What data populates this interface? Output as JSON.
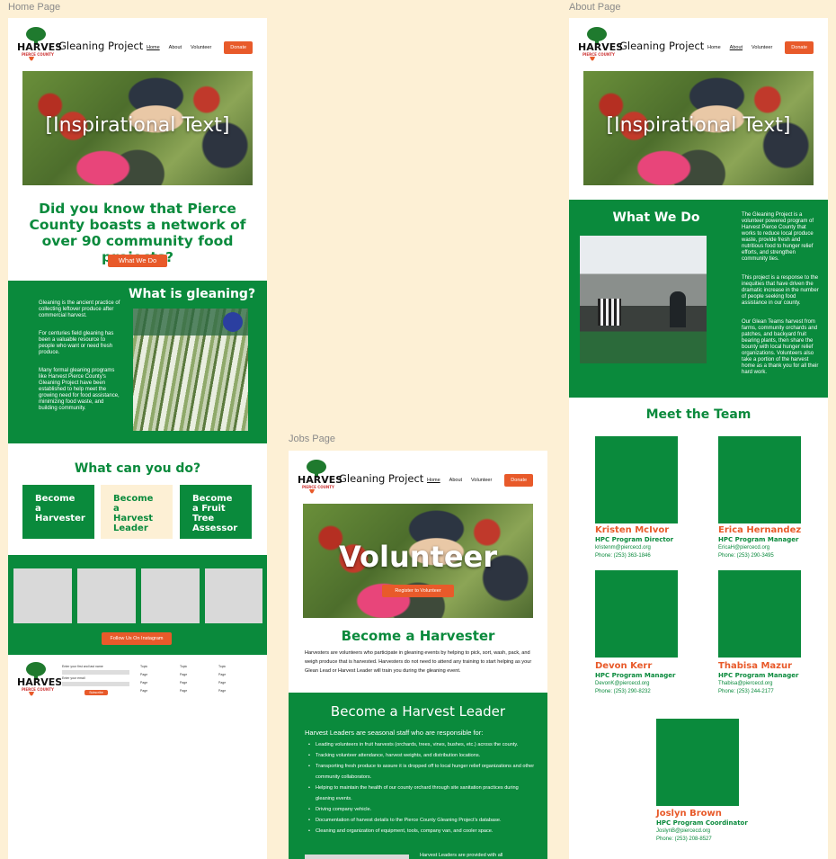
{
  "labels": {
    "home": "Home Page",
    "about": "About Page",
    "jobs": "Jobs Page"
  },
  "brand": {
    "logo_main": "HARVEST",
    "logo_sub": "PIERCE COUNTY",
    "site_title": "Gleaning Project"
  },
  "nav": {
    "home": "Home",
    "about": "About",
    "volunteer": "Volunteer",
    "donate": "Donate"
  },
  "home": {
    "hero_text": "[Inspirational Text]",
    "intro_heading": "Did you know that Pierce County boasts a network of over 90 community food projects?",
    "intro_button": "What We Do",
    "gleaning_heading": "What is gleaning?",
    "gleaning_p1": "Gleaning is the ancient practice of collecting leftover produce after commercial harvest.",
    "gleaning_p2": "For centuries field gleaning has been a valuable resource to people who want or need fresh produce.",
    "gleaning_p3": "Many formal gleaning programs like Harvest Pierce County's Gleaning Project have been established to help meet the growing need for food assistance, minimizing food waste, and building community.",
    "cando_heading": "What can you do?",
    "cards": [
      "Become a Harvester",
      "Become a Harvest Leader",
      "Become a Fruit Tree Assessor"
    ],
    "instagram_button": "Follow Us On Instagram",
    "footer": {
      "name_label": "Enter your first and last name",
      "email_label": "Enter your email",
      "subscribe": "Subscribe",
      "col_titles": [
        "Topic",
        "Topic",
        "Topic"
      ],
      "page_label": "Page"
    }
  },
  "about": {
    "hero_text": "[Inspirational Text]",
    "whatwedo_heading": "What We Do",
    "p1": "The Gleaning Project is a volunteer powered program of Harvest Pierce County that works to reduce local produce waste, provide fresh and nutritious food to hunger relief efforts, and strengthen community ties.",
    "p2": "This project is a response to the inequities that have driven the dramatic increase in the number of people seeking food assistance in our county.",
    "p3": "Our Glean Teams harvest from farms, community orchards and patches, and backyard fruit bearing plants, then share the bounty with local hunger relief organizations. Volunteers also take a portion of the harvest home as a thank you for all their hard work.",
    "team_heading": "Meet the Team",
    "team": [
      {
        "name": "Kristen McIvor",
        "role": "HPC Program Director",
        "email": "kristenm@piercecd.org",
        "phone": "Phone: (253) 363-1846"
      },
      {
        "name": "Erica Hernandez",
        "role": "HPC Program Manager",
        "email": "EricaH@piercecd.org",
        "phone": "Phone: (253) 290-3495"
      },
      {
        "name": "Devon Kerr",
        "role": "HPC Program Manager",
        "email": "DevonK@piercecd.org",
        "phone": "Phone: (253) 290-8232"
      },
      {
        "name": "Thabisa Mazur",
        "role": "HPC Program Manager",
        "email": "Thabisa@piercecd.org",
        "phone": "Phone: (253) 244-2177"
      },
      {
        "name": "Joslyn Brown",
        "role": "HPC Program Coordinator",
        "email": "JoslynB@piercecd.org",
        "phone": "Phone: (253) 208-8527"
      }
    ]
  },
  "jobs": {
    "hero_text": "Volunteer",
    "hero_button": "Register to Volunteer",
    "harvester_heading": "Become a Harvester",
    "harvester_text": "Harvesters are volunteers who participate in gleaning events by helping to pick, sort, wash, pack, and weigh produce that is harvested. Harvesters do not need to attend any training to start helping as your Glean Lead or Harvest Leader will train you during the gleaning event.",
    "leader_heading": "Become a Harvest Leader",
    "leader_intro": "Harvest Leaders are seasonal staff who are responsible for:",
    "leader_items": [
      "Leading volunteers in fruit harvests (orchards, trees, vines, bushes, etc.) across the county.",
      "Tracking volunteer attendance, harvest weights, and distribution locations.",
      "Transporting fresh produce to assure it is dropped off to local hunger relief organizations and other community collaborators.",
      "Helping to maintain the health of our county orchard through site sanitation practices during gleaning events.",
      "Driving company vehicle.",
      "Documentation of harvest details to the Pierce County Gleaning Project's database.",
      "Cleaning and organization of equipment, tools, company van, and cooler space."
    ],
    "leader_footer": "Harvest Leaders are provided with all"
  }
}
